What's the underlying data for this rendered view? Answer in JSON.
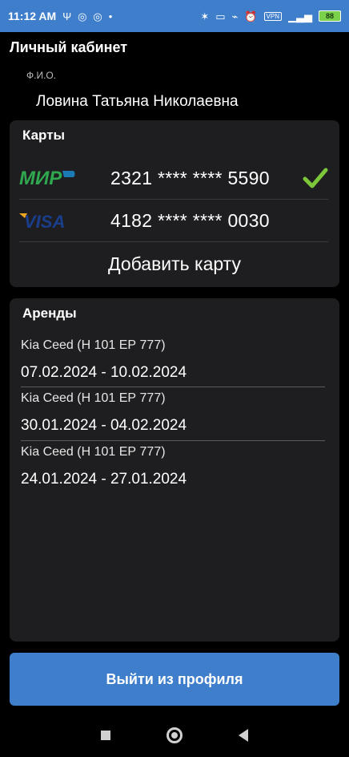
{
  "status_bar": {
    "time": "11:12 AM",
    "battery": "88",
    "vpn": "VPN"
  },
  "profile": {
    "title": "Личный кабинет",
    "fio_label": "Ф.И.О.",
    "fio_value": "Ловина Татьяна Николаевна"
  },
  "cards": {
    "title": "Карты",
    "items": [
      {
        "brand": "mir",
        "brand_text": "МИР",
        "number": "2321 **** **** 5590",
        "selected": true
      },
      {
        "brand": "visa",
        "brand_text": "VISA",
        "number": "4182 **** **** 0030",
        "selected": false
      }
    ],
    "add_label": "Добавить карту"
  },
  "rentals": {
    "title": "Аренды",
    "items": [
      {
        "car": "Kia Ceed (Н 101 ЕР 777)",
        "dates": "07.02.2024 - 10.02.2024"
      },
      {
        "car": "Kia Ceed (Н 101 ЕР 777)",
        "dates": "30.01.2024 - 04.02.2024"
      },
      {
        "car": "Kia Ceed (Н 101 ЕР 777)",
        "dates": "24.01.2024 - 27.01.2024"
      }
    ]
  },
  "logout_label": "Выйти из профиля",
  "colors": {
    "accent": "#3f7ecb",
    "panel": "#1e1e20",
    "check": "#7cc63a",
    "mir_green": "#2fa84f",
    "visa_blue": "#1a3e8c",
    "visa_gold": "#f0a51e"
  }
}
